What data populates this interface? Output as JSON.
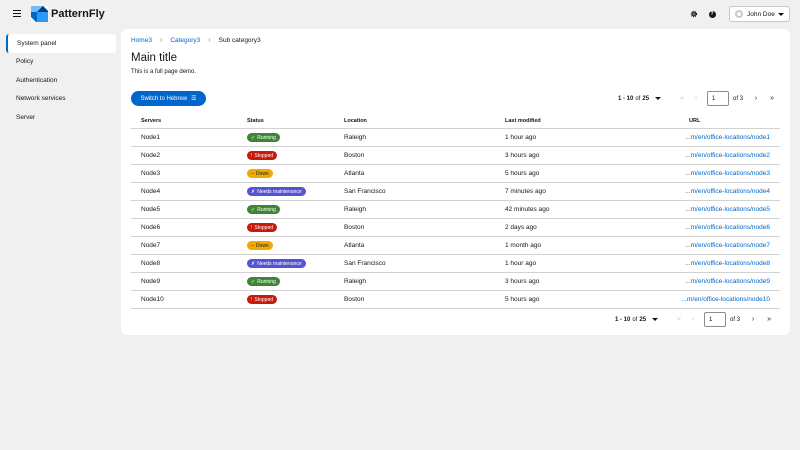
{
  "masthead": {
    "brand": "PatternFly",
    "user_name": "John Doe"
  },
  "sidebar": {
    "items": [
      {
        "label": "System panel",
        "active": true
      },
      {
        "label": "Policy",
        "active": false
      },
      {
        "label": "Authentication",
        "active": false
      },
      {
        "label": "Network services",
        "active": false
      },
      {
        "label": "Server",
        "active": false
      }
    ]
  },
  "breadcrumb": {
    "items": [
      "Home3",
      "Category3"
    ],
    "current": "Sub category3"
  },
  "page": {
    "title": "Main title",
    "subtitle": "This is a full page demo.",
    "primary_button": "Switch to Hebrew"
  },
  "pagination": {
    "range_prefix": "1 - 10",
    "range_of": "of",
    "total": "25",
    "current_page": "1",
    "of_pages": "of 3"
  },
  "table": {
    "columns": [
      "Servers",
      "Status",
      "Location",
      "Last modified",
      "URL"
    ],
    "rows": [
      {
        "server": "Node1",
        "status": "Running",
        "status_type": "running",
        "location": "Raleigh",
        "modified": "1 hour ago",
        "url": "...m/en/office-locations/node1"
      },
      {
        "server": "Node2",
        "status": "Stopped",
        "status_type": "stopped",
        "location": "Boston",
        "modified": "3 hours ago",
        "url": "...m/en/office-locations/node2"
      },
      {
        "server": "Node3",
        "status": "Down",
        "status_type": "down",
        "location": "Atlanta",
        "modified": "5 hours ago",
        "url": "...m/en/office-locations/node3"
      },
      {
        "server": "Node4",
        "status": "Needs maintenance",
        "status_type": "maint",
        "location": "San Francisco",
        "modified": "7 minutes ago",
        "url": "...m/en/office-locations/node4"
      },
      {
        "server": "Node5",
        "status": "Running",
        "status_type": "running",
        "location": "Raleigh",
        "modified": "42 minutes ago",
        "url": "...m/en/office-locations/node5"
      },
      {
        "server": "Node6",
        "status": "Stopped",
        "status_type": "stopped",
        "location": "Boston",
        "modified": "2 days ago",
        "url": "...m/en/office-locations/node6"
      },
      {
        "server": "Node7",
        "status": "Down",
        "status_type": "down",
        "location": "Atlanta",
        "modified": "1 month ago",
        "url": "...m/en/office-locations/node7"
      },
      {
        "server": "Node8",
        "status": "Needs maintenance",
        "status_type": "maint",
        "location": "San Francisco",
        "modified": "1 hour ago",
        "url": "...m/en/office-locations/node8"
      },
      {
        "server": "Node9",
        "status": "Running",
        "status_type": "running",
        "location": "Raleigh",
        "modified": "3 hours ago",
        "url": "...m/en/office-locations/node9"
      },
      {
        "server": "Node10",
        "status": "Stopped",
        "status_type": "stopped",
        "location": "Boston",
        "modified": "5 hours ago",
        "url": "...m/en/office-locations/node10"
      }
    ]
  },
  "status_icons": {
    "running": "check-circle-icon",
    "stopped": "exclamation-circle-icon",
    "down": "minus-circle-icon",
    "maint": "wrench-icon"
  },
  "colors": {
    "primary": "#0066cc",
    "running": "#3e8635",
    "stopped": "#c9190b",
    "down": "#f0ab00",
    "maint": "#5752d1"
  }
}
